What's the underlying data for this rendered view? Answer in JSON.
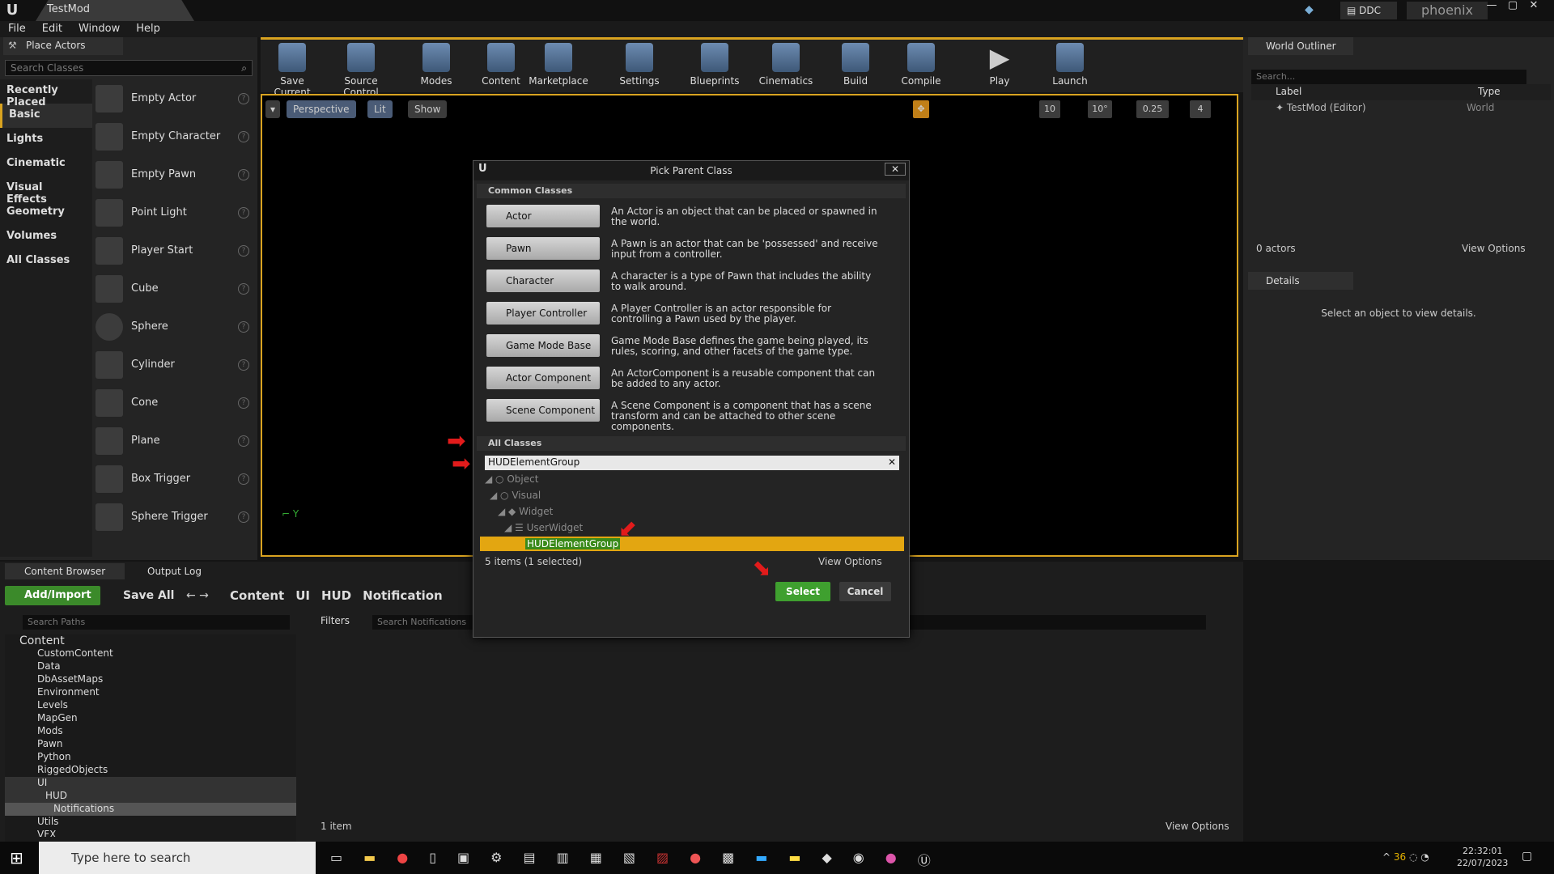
{
  "window": {
    "tab_title": "TestMod",
    "ddc": "DDC",
    "project": "phoenix"
  },
  "menu": [
    "File",
    "Edit",
    "Window",
    "Help"
  ],
  "place_actors": {
    "tab": "Place Actors",
    "search_placeholder": "Search Classes",
    "categories": [
      "Recently Placed",
      "Basic",
      "Lights",
      "Cinematic",
      "Visual Effects",
      "Geometry",
      "Volumes",
      "All Classes"
    ],
    "items": [
      "Empty Actor",
      "Empty Character",
      "Empty Pawn",
      "Point Light",
      "Player Start",
      "Cube",
      "Sphere",
      "Cylinder",
      "Cone",
      "Plane",
      "Box Trigger",
      "Sphere Trigger"
    ]
  },
  "toolbar": [
    "Save Current",
    "Source Control",
    "Modes",
    "Content",
    "Marketplace",
    "Settings",
    "Blueprints",
    "Cinematics",
    "Build",
    "Compile",
    "Play",
    "Launch"
  ],
  "viewport": {
    "perspective": "Perspective",
    "lit": "Lit",
    "show": "Show",
    "snap1": "10",
    "snap2": "10°",
    "snap3": "0.25",
    "snap4": "4"
  },
  "outliner": {
    "tab": "World Outliner",
    "search_placeholder": "Search...",
    "col_label": "Label",
    "col_type": "Type",
    "row_label": "TestMod (Editor)",
    "row_type": "World",
    "count": "0 actors",
    "view_options": "View Options"
  },
  "details": {
    "tab": "Details",
    "empty": "Select an object to view details."
  },
  "content_browser": {
    "tab1": "Content Browser",
    "tab2": "Output Log",
    "add_import": "Add/Import",
    "save_all": "Save All",
    "breadcrumb": [
      "Content",
      "UI",
      "HUD",
      "Notification"
    ],
    "search_paths": "Search Paths",
    "filters": "Filters",
    "search_notifications": "Search Notifications",
    "tree": [
      "Content",
      "CustomContent",
      "Data",
      "DbAssetMaps",
      "Environment",
      "Levels",
      "MapGen",
      "Mods",
      "Pawn",
      "Python",
      "RiggedObjects",
      "UI",
      "HUD",
      "Notifications",
      "Utils",
      "VFX"
    ],
    "item_count": "1 item",
    "view_options": "View Options"
  },
  "dialog": {
    "title": "Pick Parent Class",
    "common_header": "Common Classes",
    "classes": [
      {
        "name": "Actor",
        "desc": "An Actor is an object that can be placed or spawned in the world."
      },
      {
        "name": "Pawn",
        "desc": "A Pawn is an actor that can be 'possessed' and receive input from a controller."
      },
      {
        "name": "Character",
        "desc": "A character is a type of Pawn that includes the ability to walk around."
      },
      {
        "name": "Player Controller",
        "desc": "A Player Controller is an actor responsible for controlling a Pawn used by the player."
      },
      {
        "name": "Game Mode Base",
        "desc": "Game Mode Base defines the game being played, its rules, scoring, and other facets of the game type."
      },
      {
        "name": "Actor Component",
        "desc": "An ActorComponent is a reusable component that can be added to any actor."
      },
      {
        "name": "Scene Component",
        "desc": "A Scene Component is a component that has a scene transform and can be attached to other scene components."
      }
    ],
    "all_header": "All Classes",
    "search_value": "HUDElementGroup",
    "tree": [
      "Object",
      "Visual",
      "Widget",
      "UserWidget",
      "HUDElementGroup"
    ],
    "status": "5 items (1 selected)",
    "view_options": "View Options",
    "select": "Select",
    "cancel": "Cancel"
  },
  "taskbar": {
    "search": "Type here to search",
    "time": "22:32:01",
    "date": "22/07/2023",
    "temp": "36"
  }
}
